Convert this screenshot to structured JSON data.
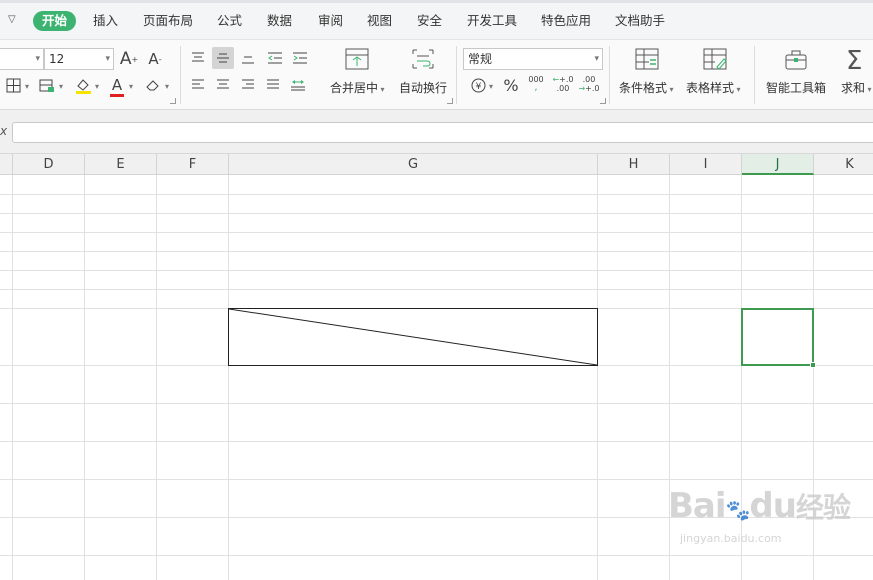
{
  "menu": {
    "items": [
      "开始",
      "插入",
      "页面布局",
      "公式",
      "数据",
      "审阅",
      "视图",
      "安全",
      "开发工具",
      "特色应用",
      "文档助手"
    ],
    "active_index": 0,
    "accent": "#3cb371"
  },
  "ribbon": {
    "font_size": "12",
    "number_format": "常规",
    "merge_center": "合并居中",
    "wrap_text": "自动换行",
    "cond_format": "条件格式",
    "table_style": "表格样式",
    "toolbox": "智能工具箱",
    "sum": "求和",
    "percent": "%",
    "thousands": "000",
    "thousands_sub": ",",
    "dec_more_top": "+.0",
    "dec_more_bot": ".00",
    "dec_less_top": ".00",
    "dec_less_bot": "+.0",
    "grow_font": "A",
    "shrink_font": "A",
    "font_color_glyph": "A",
    "font_color": "#e02020",
    "fill_color": "#f5e400"
  },
  "formula_bar": {
    "fx_label": "x",
    "value": ""
  },
  "sheet": {
    "columns": [
      "D",
      "E",
      "F",
      "G",
      "H",
      "I",
      "J",
      "K"
    ],
    "selected_column": "J",
    "selection_color": "#3d9a4f"
  },
  "watermark": {
    "logo_text": "Bai",
    "logo_text2": "du",
    "logo_suffix": "经验",
    "url": "jingyan.baidu.com"
  }
}
